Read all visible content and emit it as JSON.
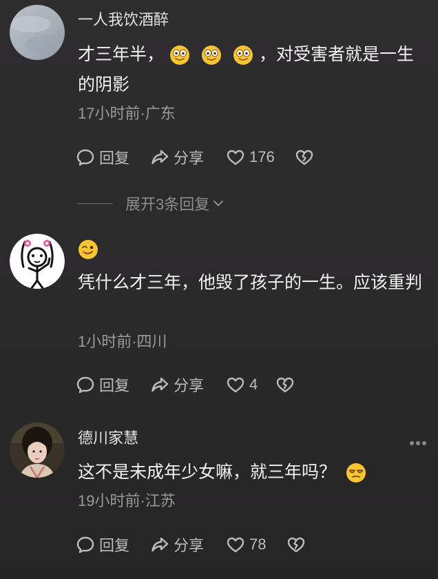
{
  "comments": [
    {
      "username": "一人我饮酒醉",
      "text_a": "才三年半，",
      "text_b": "，对受害者就是一生的阴影",
      "meta": "17小时前·广东",
      "reply_label": "回复",
      "share_label": "分享",
      "likes": "176",
      "emojis": [
        "grin-emoji",
        "grin-emoji",
        "grin-emoji"
      ]
    },
    {
      "username": "",
      "text_top_emoji": "wink-emoji",
      "text": "凭什么才三年，他毁了孩子的一生。应该重判",
      "meta": "1小时前·四川",
      "reply_label": "回复",
      "share_label": "分享",
      "likes": "4"
    },
    {
      "username": "德川家慧",
      "text": "这不是未成年少女嘛，就三年吗？",
      "text_emoji": "smug-emoji",
      "meta": "19小时前·江苏",
      "reply_label": "回复",
      "share_label": "分享",
      "likes": "78"
    }
  ],
  "expand_replies": "展开3条回复",
  "colors": {
    "background": "#2c2b2c",
    "text": "#f2f2f2",
    "meta": "#9a9a9a",
    "emoji": "#f7c531"
  }
}
